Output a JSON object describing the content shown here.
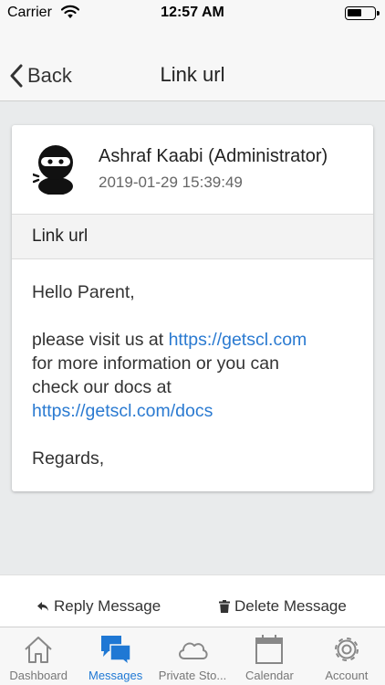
{
  "status_bar": {
    "carrier": "Carrier",
    "time": "12:57 AM"
  },
  "nav": {
    "back_label": "Back",
    "title": "Link url"
  },
  "message": {
    "sender_name": "Ashraf Kaabi (Administrator)",
    "date": "2019-01-29 15:39:49",
    "subject": "Link url",
    "greeting": "Hello Parent,",
    "line1_prefix": "please visit us at ",
    "link1": "https://getscl.com",
    "line2": "for more information or you can",
    "line3": "check our docs at",
    "link2": "https://getscl.com/docs",
    "closing": "Regards,"
  },
  "actions": {
    "reply": "Reply Message",
    "delete": "Delete Message"
  },
  "tabs": [
    {
      "label": "Dashboard",
      "icon": "home-icon"
    },
    {
      "label": "Messages",
      "icon": "messages-icon"
    },
    {
      "label": "Private Sto...",
      "icon": "cloud-icon"
    },
    {
      "label": "Calendar",
      "icon": "calendar-icon"
    },
    {
      "label": "Account",
      "icon": "gear-icon"
    }
  ],
  "colors": {
    "accent": "#1f78d4",
    "link": "#2a7ad1"
  }
}
